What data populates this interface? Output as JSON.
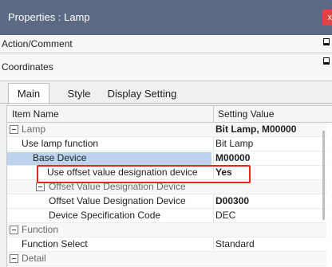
{
  "window": {
    "title": "Properties : Lamp",
    "close_label": "x"
  },
  "sections": [
    {
      "label": "Action/Comment"
    },
    {
      "label": "Coordinates"
    }
  ],
  "tabs": [
    {
      "label": "Main",
      "active": true
    },
    {
      "label": "Style",
      "active": false
    },
    {
      "label": "Display Setting",
      "active": false
    }
  ],
  "grid": {
    "columns": [
      "Item Name",
      "Setting Value"
    ],
    "rows": [
      {
        "name": "Lamp",
        "value": "Bit Lamp, M00000",
        "category": true,
        "collapsible": true
      },
      {
        "name": "Use lamp function",
        "value": "Bit Lamp"
      },
      {
        "name": "Base Device",
        "value": "M00000",
        "selected": true
      },
      {
        "name": "Use offset value designation device",
        "value": "Yes",
        "highlighted": true
      },
      {
        "name": "Offset Value Designation Device",
        "value": "",
        "category": true,
        "collapsible": true
      },
      {
        "name": "Offset Value Designation Device",
        "value": "D00300"
      },
      {
        "name": "Device Specification Code",
        "value": "DEC"
      },
      {
        "name": "Function",
        "value": "",
        "category": true,
        "collapsible": true
      },
      {
        "name": "Function Select",
        "value": "Standard"
      },
      {
        "name": "Detail",
        "value": "",
        "category": true,
        "collapsible": true
      }
    ]
  },
  "colors": {
    "titlebar": "#5b6a82",
    "highlight_border": "#e8261e",
    "selection": "#bcd3ee"
  }
}
